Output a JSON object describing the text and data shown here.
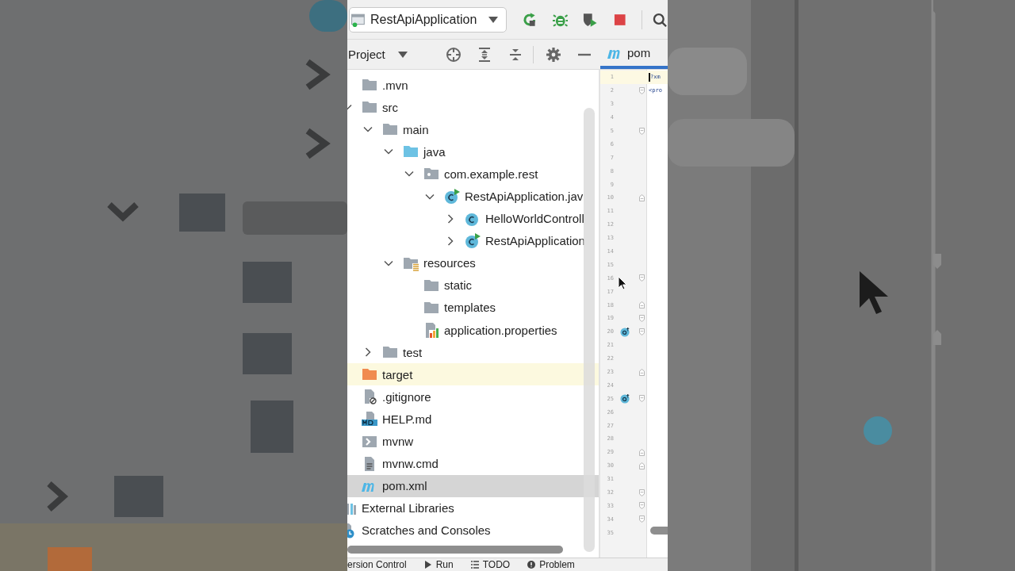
{
  "toolbar": {
    "run_config": {
      "label": "RestApiApplication",
      "running": true
    }
  },
  "project_panel": {
    "title": "Project",
    "items": [
      {
        "label": ".mvn",
        "kind": "folder",
        "selected": false
      },
      {
        "label": "src",
        "kind": "folder",
        "selected": false,
        "expanded": true,
        "children": [
          {
            "label": "main",
            "kind": "folder",
            "selected": false,
            "expanded": true,
            "children": [
              {
                "label": "java",
                "kind": "source-folder",
                "selected": false,
                "expanded": true,
                "children": [
                  {
                    "label": "com.example.rest",
                    "kind": "package",
                    "selected": false,
                    "expanded": true,
                    "children": [
                      {
                        "label": "RestApiApplication.jav",
                        "kind": "run-class",
                        "selected": false,
                        "expanded": true,
                        "children": [
                          {
                            "label": "HelloWorldControll",
                            "kind": "class",
                            "selected": false,
                            "expanded": false
                          },
                          {
                            "label": "RestApiApplication",
                            "kind": "run-class",
                            "selected": false,
                            "expanded": false
                          }
                        ]
                      }
                    ]
                  }
                ]
              },
              {
                "label": "resources",
                "kind": "resources",
                "selected": false,
                "expanded": true,
                "children": [
                  {
                    "label": "static",
                    "kind": "folder",
                    "selected": false
                  },
                  {
                    "label": "templates",
                    "kind": "folder",
                    "selected": false
                  },
                  {
                    "label": "application.properties",
                    "kind": "properties",
                    "selected": false
                  }
                ]
              }
            ]
          },
          {
            "label": "test",
            "kind": "folder",
            "selected": false,
            "expanded": false
          }
        ]
      },
      {
        "label": "target",
        "kind": "excluded-folder",
        "selected": false,
        "highlighted": true
      },
      {
        "label": ".gitignore",
        "kind": "ignore-file",
        "selected": false
      },
      {
        "label": "HELP.md",
        "kind": "markdown",
        "selected": false
      },
      {
        "label": "mvnw",
        "kind": "script",
        "selected": false
      },
      {
        "label": "mvnw.cmd",
        "kind": "text",
        "selected": false
      },
      {
        "label": "pom.xml",
        "kind": "maven",
        "selected": true
      }
    ],
    "root_items": [
      {
        "label": "External Libraries",
        "kind": "libraries",
        "selected": false
      },
      {
        "label": "Scratches and Consoles",
        "kind": "scratches",
        "selected": false
      }
    ]
  },
  "editor": {
    "tab": {
      "label": "pom",
      "selected": true
    },
    "lines": [
      {
        "number": "1",
        "current": true,
        "overridden": false,
        "code": "?xm",
        "kind": "plain"
      },
      {
        "number": "2",
        "current": false,
        "overridden": false,
        "code": "<pro",
        "kind": "fold-start"
      },
      {
        "number": "3",
        "current": false,
        "overridden": false,
        "kind": "plain"
      },
      {
        "number": "4",
        "current": false,
        "overridden": false,
        "kind": "plain"
      },
      {
        "number": "5",
        "current": false,
        "overridden": false,
        "kind": "fold-start"
      },
      {
        "number": "6",
        "current": false,
        "overridden": false,
        "kind": "plain"
      },
      {
        "number": "7",
        "current": false,
        "overridden": false,
        "kind": "plain"
      },
      {
        "number": "8",
        "current": false,
        "overridden": false,
        "kind": "plain"
      },
      {
        "number": "9",
        "current": false,
        "overridden": false,
        "kind": "plain"
      },
      {
        "number": "10",
        "current": false,
        "overridden": false,
        "kind": "fold-end"
      },
      {
        "number": "11",
        "current": false,
        "overridden": false,
        "kind": "plain"
      },
      {
        "number": "12",
        "current": false,
        "overridden": false,
        "kind": "plain"
      },
      {
        "number": "13",
        "current": false,
        "overridden": false,
        "kind": "plain"
      },
      {
        "number": "14",
        "current": false,
        "overridden": false,
        "kind": "plain"
      },
      {
        "number": "15",
        "current": false,
        "overridden": false,
        "kind": "plain"
      },
      {
        "number": "16",
        "current": false,
        "overridden": false,
        "kind": "fold-start"
      },
      {
        "number": "17",
        "current": false,
        "overridden": false,
        "kind": "plain"
      },
      {
        "number": "18",
        "current": false,
        "overridden": false,
        "kind": "fold-end"
      },
      {
        "number": "19",
        "current": false,
        "overridden": false,
        "kind": "fold-start"
      },
      {
        "number": "20",
        "current": false,
        "overridden": true,
        "kind": "fold-start"
      },
      {
        "number": "21",
        "current": false,
        "overridden": false,
        "kind": "plain"
      },
      {
        "number": "22",
        "current": false,
        "overridden": false,
        "kind": "plain"
      },
      {
        "number": "23",
        "current": false,
        "overridden": false,
        "kind": "fold-end"
      },
      {
        "number": "24",
        "current": false,
        "overridden": false,
        "kind": "plain"
      },
      {
        "number": "25",
        "current": false,
        "overridden": true,
        "kind": "fold-start"
      },
      {
        "number": "26",
        "current": false,
        "overridden": false,
        "kind": "plain"
      },
      {
        "number": "27",
        "current": false,
        "overridden": false,
        "kind": "plain"
      },
      {
        "number": "28",
        "current": false,
        "overridden": false,
        "kind": "plain"
      },
      {
        "number": "29",
        "current": false,
        "overridden": false,
        "kind": "fold-end"
      },
      {
        "number": "30",
        "current": false,
        "overridden": false,
        "kind": "fold-end"
      },
      {
        "number": "31",
        "current": false,
        "overridden": false,
        "kind": "plain"
      },
      {
        "number": "32",
        "current": false,
        "overridden": false,
        "kind": "fold-start"
      },
      {
        "number": "33",
        "current": false,
        "overridden": false,
        "kind": "fold-start"
      },
      {
        "number": "34",
        "current": false,
        "overridden": false,
        "kind": "fold-start"
      },
      {
        "number": "35",
        "current": false,
        "overridden": false,
        "kind": "plain"
      }
    ]
  },
  "bottom_bar": [
    {
      "label": "ersion Control",
      "kind": "vcs"
    },
    {
      "label": "Run",
      "kind": "run"
    },
    {
      "label": "TODO",
      "kind": "todo"
    },
    {
      "label": "Problem",
      "kind": "problems"
    }
  ]
}
